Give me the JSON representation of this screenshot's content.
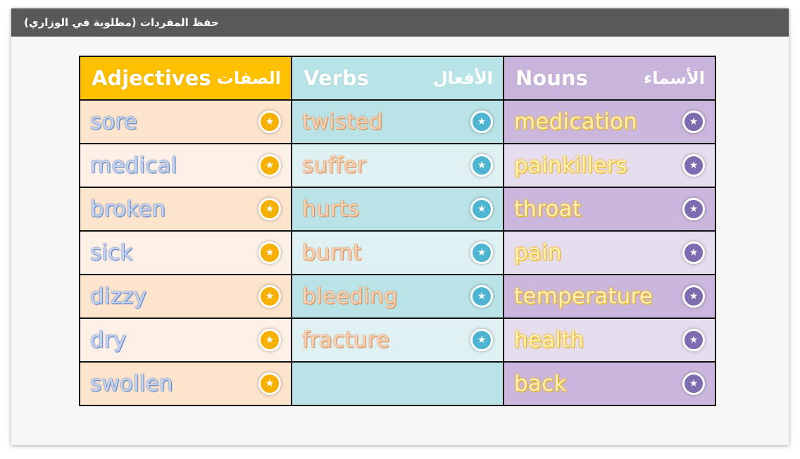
{
  "header": {
    "title": "حفظ المفردات (مطلوبة في الوزاري)"
  },
  "table": {
    "columns": [
      {
        "en": "Adjectives",
        "ar": "الصفات"
      },
      {
        "en": "Verbs",
        "ar": "الأفعال"
      },
      {
        "en": "Nouns",
        "ar": "الأسماء"
      }
    ],
    "adjectives": [
      "sore",
      "medical",
      "broken",
      "sick",
      "dizzy",
      "dry",
      "swollen"
    ],
    "verbs": [
      "twisted",
      "suffer",
      "hurts",
      "burnt",
      "bleeding",
      "fracture",
      ""
    ],
    "nouns": [
      "medication",
      "painkillers",
      "throat",
      "pain",
      "temperature",
      "health",
      "back"
    ],
    "star_icon": "★"
  },
  "colors": {
    "header_bar": "#595959",
    "adjectives_header": "#ffc000",
    "verbs_header": "#b8e3e7",
    "nouns_header": "#c9b5dc"
  }
}
